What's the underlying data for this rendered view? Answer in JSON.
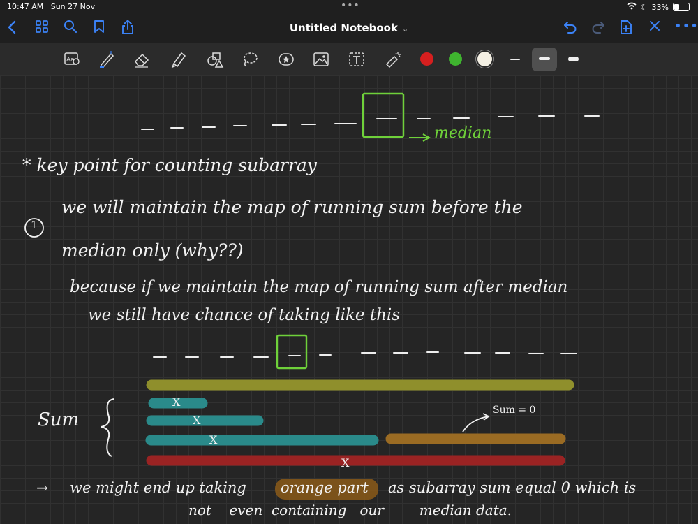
{
  "status": {
    "time": "10:47 AM",
    "date": "Sun 27 Nov",
    "battery": "33%",
    "battery_level": 0.33
  },
  "app": {
    "title": "Untitled Notebook"
  },
  "toolbar": {
    "colors": {
      "red": "#d61f1f",
      "green": "#3fb42f",
      "white": "#f4f0e4"
    },
    "accent": "#3b82f6"
  },
  "notes": {
    "median_label": "median",
    "heading": "* key point for counting subarray",
    "point1_num": "1",
    "point1_line1": "we will maintain the map of running sum before the",
    "point1_line2": "median only (why??)",
    "because_line1": "because if we maintain the map of running sum after median",
    "because_line2": "we still have  chance of taking  like this",
    "sum_label": "Sum",
    "sum_zero": "Sum = 0",
    "x_mark": "X",
    "conclusion_arrow": "→",
    "conclusion_line1_a": "we might end up taking",
    "conclusion_orange": "orange part",
    "conclusion_line1_b": "as subarray sum equal 0 which is",
    "conclusion_line2": "not    even  containing   our        median data."
  }
}
